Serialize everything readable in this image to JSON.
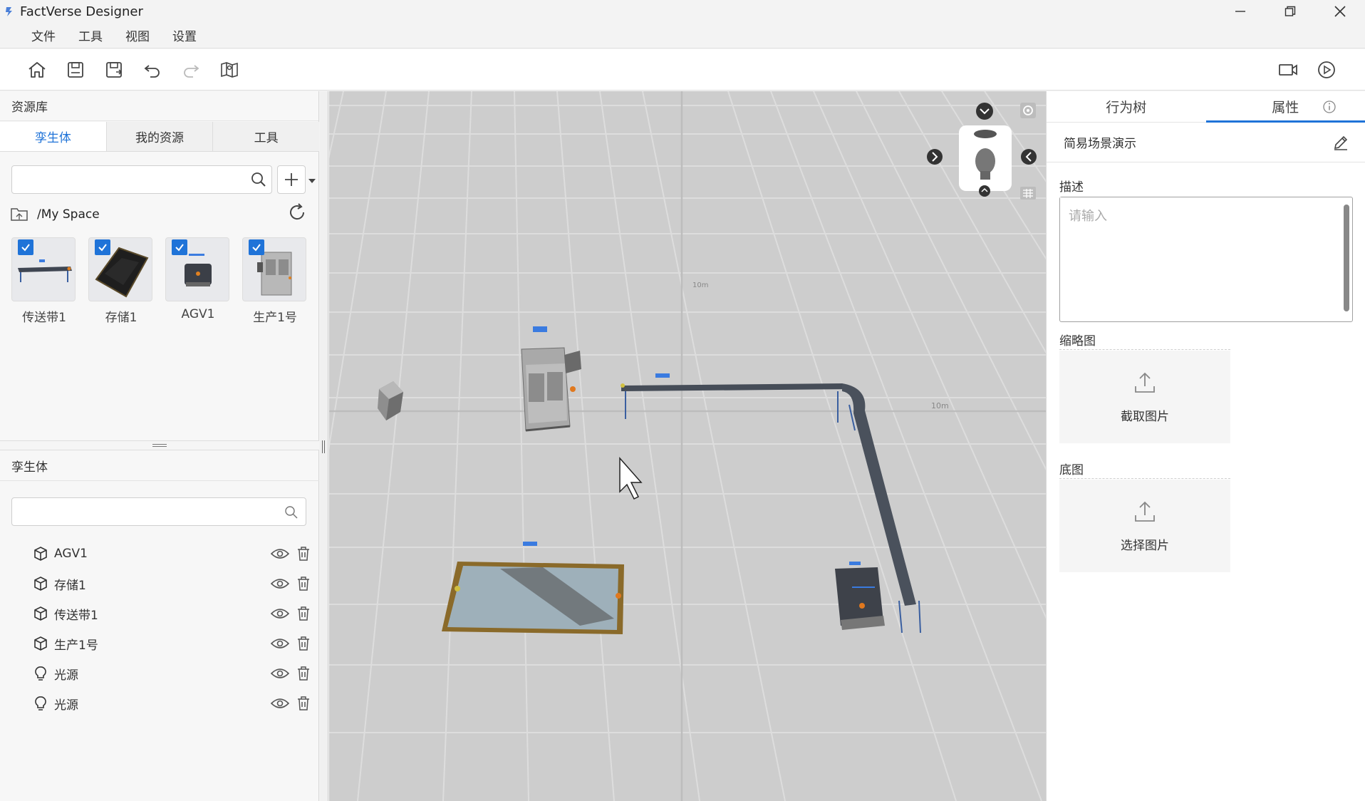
{
  "app": {
    "title": "FactVerse Designer"
  },
  "menu": [
    "文件",
    "工具",
    "视图",
    "设置"
  ],
  "left": {
    "library_title": "资源库",
    "tabs": [
      "孪生体",
      "我的资源",
      "工具"
    ],
    "search_placeholder": "",
    "path": "/My Space",
    "assets": [
      {
        "label": "传送带1"
      },
      {
        "label": "存储1"
      },
      {
        "label": "AGV1"
      },
      {
        "label": "生产1号"
      }
    ],
    "twin_title": "孪生体",
    "twin_search_placeholder": "",
    "tree": [
      {
        "label": "AGV1",
        "icon": "cube-icon"
      },
      {
        "label": "存储1",
        "icon": "cube-icon"
      },
      {
        "label": "传送带1",
        "icon": "cube-icon"
      },
      {
        "label": "生产1号",
        "icon": "cube-icon"
      },
      {
        "label": "光源",
        "icon": "lightbulb-icon"
      },
      {
        "label": "光源",
        "icon": "lightbulb-icon"
      }
    ]
  },
  "viewport": {
    "scale_labels": [
      "10m",
      "10m"
    ]
  },
  "right": {
    "tabs": [
      "行为树",
      "属性"
    ],
    "scene_name": "简易场景演示",
    "desc_label": "描述",
    "desc_placeholder": "请输入",
    "thumb_label": "缩略图",
    "thumb_action": "截取图片",
    "base_label": "底图",
    "base_action": "选择图片"
  },
  "colors": {
    "accent": "#1f73d8",
    "viewport_bg": "#cfcfcf"
  }
}
